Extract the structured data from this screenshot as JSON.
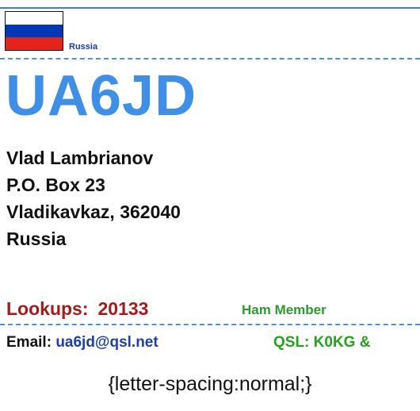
{
  "flag": {
    "icon": "russia-flag-icon",
    "colors": [
      "#ffffff",
      "#0038b8",
      "#e3241b"
    ]
  },
  "header": {
    "country_small": "Russia"
  },
  "profile": {
    "callsign": "UA6JD",
    "address": [
      "Vlad Lambrianov",
      "P.O. Box 23",
      "Vladikavkaz, 362040",
      "Russia"
    ]
  },
  "stats": {
    "lookups_label": "Lookups:",
    "lookups_value": "20133",
    "member_label": "Ham Member"
  },
  "contact": {
    "email_label": "Email:",
    "email_value": "ua6jd@qsl.net",
    "qsl_text": "QSL: K0KG &"
  },
  "footer": {
    "css_note": "{letter-spacing:normal;}"
  },
  "colors": {
    "callsign": "#3f8fe6",
    "lookups": "#a11c1c",
    "member": "#2e9a2e",
    "email_link": "#1f3fa8",
    "qsl": "#26a11f",
    "rule": "#4e8fd8"
  }
}
